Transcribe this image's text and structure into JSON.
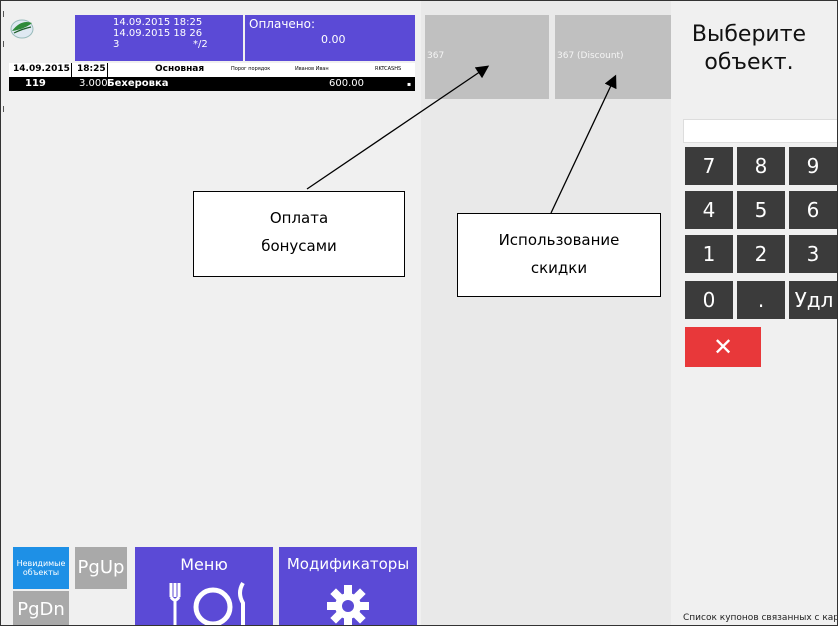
{
  "order_info": {
    "datetime1": "14.09.2015 18:25",
    "datetime2": "14.09.2015 18 26",
    "guests": "3",
    "table": "*/2"
  },
  "payment": {
    "label": "Оплачено:",
    "value": "0.00"
  },
  "order_header": {
    "date": "14.09.2015",
    "time": "18:25",
    "category": "Основная",
    "order_by": "Порог порядок",
    "waiter": "Иванов Иван",
    "cashier": "RKTCASHS"
  },
  "order_items": [
    {
      "code": "119",
      "qty": "3.000",
      "name": "Бехеровка",
      "price": "600.00"
    }
  ],
  "bottom_buttons": {
    "invisible_objects": "Невидимые объекты",
    "pgup": "PgUp",
    "pgdn": "PgDn",
    "menu": "Меню",
    "modifiers": "Модификаторы"
  },
  "tiles": [
    {
      "label": "367"
    },
    {
      "label": "367 (Discount)"
    }
  ],
  "right_panel": {
    "title_line1": "Выберите",
    "title_line2": "объект.",
    "keys": [
      "7",
      "8",
      "9",
      "4",
      "5",
      "6",
      "1",
      "2",
      "3",
      "0",
      ".",
      "Удл"
    ],
    "cancel": "✕",
    "coupon_text": "Список купонов связанных с кар"
  },
  "callouts": {
    "bonus_line1": "Оплата",
    "bonus_line2": "бонусами",
    "discount_line1": "Использование",
    "discount_line2": "скидки"
  },
  "colors": {
    "purple": "#5b4ad6",
    "blue": "#1e90e6",
    "key_dark": "#3b3b3b",
    "cancel_red": "#e8383a",
    "tile_gray": "#c0c0c0"
  }
}
